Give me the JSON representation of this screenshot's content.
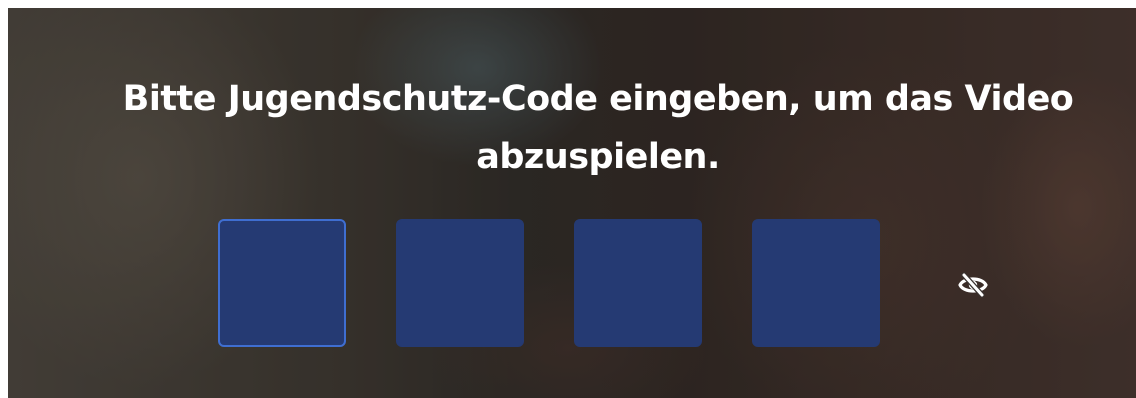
{
  "prompt": {
    "text": "Bitte Jugendschutz-Code eingeben, um das Video abzuspielen."
  },
  "code_inputs": [
    {
      "value": ""
    },
    {
      "value": ""
    },
    {
      "value": ""
    },
    {
      "value": ""
    }
  ],
  "visibility_toggle": {
    "icon": "eye-off-icon"
  },
  "colors": {
    "input_fill": "#253a73",
    "input_focus_border": "#3f6ed1",
    "text": "#ffffff"
  }
}
